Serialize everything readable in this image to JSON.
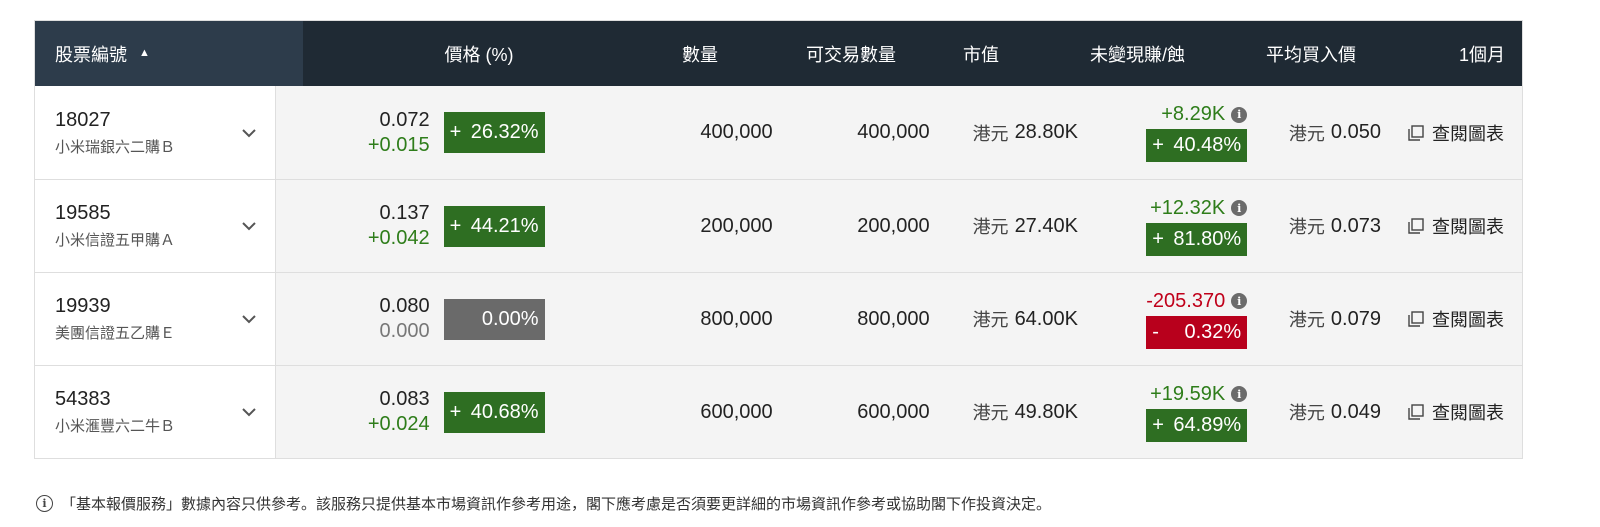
{
  "header": {
    "stock_no": "股票編號",
    "price_pct": "價格 (%)",
    "quantity": "數量",
    "tradable_qty": "可交易數量",
    "market_value": "市值",
    "unrealized_pnl": "未變現賺/蝕",
    "avg_buy_price": "平均買入價",
    "one_month": "1個月"
  },
  "rows": [
    {
      "code": "18027",
      "name": "小米瑞銀六二購Ｂ",
      "price": "0.072",
      "change": "+0.015",
      "change_dir": "pos",
      "pct_sign": "+",
      "pct": "26.32%",
      "pct_dir": "pos",
      "quantity": "400,000",
      "tradable": "400,000",
      "mv_currency": "港元",
      "mv": "28.80K",
      "pnl": "+8.29K",
      "pnl_dir": "pos",
      "pnl_sign": "+",
      "pnl_pct": "40.48%",
      "avg_currency": "港元",
      "avg": "0.050",
      "chart_label": "查閱圖表"
    },
    {
      "code": "19585",
      "name": "小米信證五甲購Ａ",
      "price": "0.137",
      "change": "+0.042",
      "change_dir": "pos",
      "pct_sign": "+",
      "pct": "44.21%",
      "pct_dir": "pos",
      "quantity": "200,000",
      "tradable": "200,000",
      "mv_currency": "港元",
      "mv": "27.40K",
      "pnl": "+12.32K",
      "pnl_dir": "pos",
      "pnl_sign": "+",
      "pnl_pct": "81.80%",
      "avg_currency": "港元",
      "avg": "0.073",
      "chart_label": "查閱圖表"
    },
    {
      "code": "19939",
      "name": "美團信證五乙購Ｅ",
      "price": "0.080",
      "change": "0.000",
      "change_dir": "neu",
      "pct_sign": "",
      "pct": "0.00%",
      "pct_dir": "neu",
      "quantity": "800,000",
      "tradable": "800,000",
      "mv_currency": "港元",
      "mv": "64.00K",
      "pnl": "-205.370",
      "pnl_dir": "neg",
      "pnl_sign": "-",
      "pnl_pct": "0.32%",
      "avg_currency": "港元",
      "avg": "0.079",
      "chart_label": "查閱圖表"
    },
    {
      "code": "54383",
      "name": "小米滙豐六二牛Ｂ",
      "price": "0.083",
      "change": "+0.024",
      "change_dir": "pos",
      "pct_sign": "+",
      "pct": "40.68%",
      "pct_dir": "pos",
      "quantity": "600,000",
      "tradable": "600,000",
      "mv_currency": "港元",
      "mv": "49.80K",
      "pnl": "+19.59K",
      "pnl_dir": "pos",
      "pnl_sign": "+",
      "pnl_pct": "64.89%",
      "avg_currency": "港元",
      "avg": "0.049",
      "chart_label": "查閱圖表"
    }
  ],
  "footer": {
    "disclaimer": "「基本報價服務」數據內容只供參考。該服務只提供基本市場資訊作參考用途，閣下應考慮是否須要更詳細的市場資訊作參考或協助閣下作投資決定。"
  },
  "colors": {
    "header_bg": "#1f2a34",
    "header_stock_bg": "#2d3c4b",
    "positive": "#2e7d1a",
    "positive_badge": "#2e6e22",
    "negative": "#c0001a",
    "negative_badge": "#b8001c",
    "neutral_badge": "#6a6a6a"
  },
  "icons": {
    "sort": "caret-up-icon",
    "expand": "chevron-down-icon",
    "info": "info-icon",
    "chart": "chart-window-icon"
  }
}
